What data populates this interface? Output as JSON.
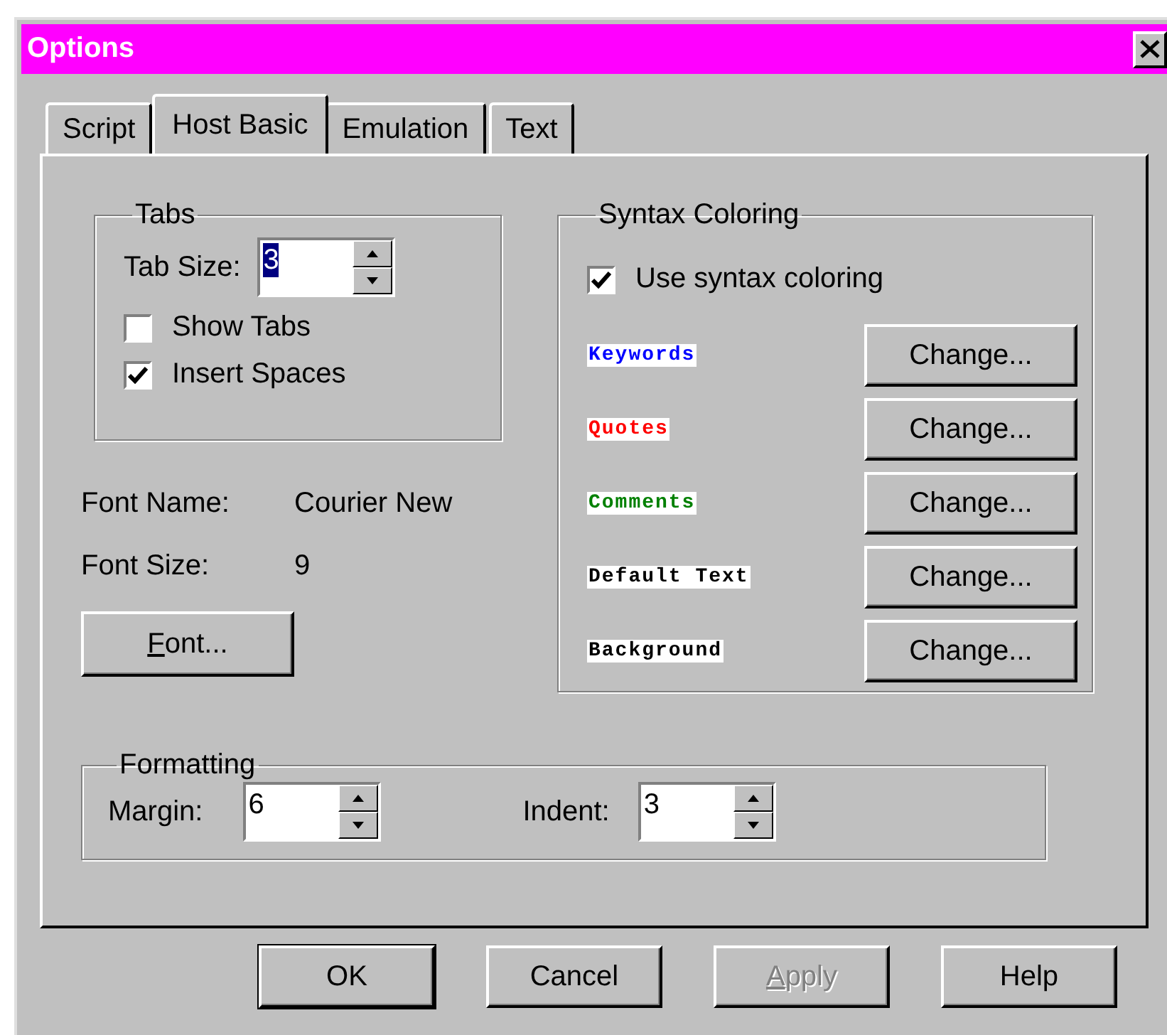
{
  "window": {
    "title": "Options"
  },
  "tabs": [
    {
      "label": "Script",
      "selected": false
    },
    {
      "label": "Host Basic",
      "selected": true
    },
    {
      "label": "Emulation",
      "selected": false
    },
    {
      "label": "Text",
      "selected": false
    }
  ],
  "tabs_group": {
    "title": "Tabs",
    "tab_size": {
      "label": "Tab Size:",
      "value": "3",
      "highlighted": true
    },
    "checkboxes": [
      {
        "label": "Show Tabs",
        "checked": false
      },
      {
        "label": "Insert Spaces",
        "checked": true
      }
    ]
  },
  "font_info": [
    {
      "label": "Font Name:",
      "value": "Courier New"
    },
    {
      "label": "Font Size:",
      "value": "9"
    }
  ],
  "font_button": {
    "label": "Font...",
    "underline_first": true
  },
  "syntax": {
    "title": "Syntax Coloring",
    "use_syntax": {
      "label": "Use syntax coloring",
      "checked": true
    },
    "items": [
      {
        "label": "Keywords",
        "color": "#0000ff",
        "button": "Change..."
      },
      {
        "label": "Quotes",
        "color": "#ff0000",
        "button": "Change..."
      },
      {
        "label": "Comments",
        "color": "#008000",
        "button": "Change..."
      },
      {
        "label": "Default Text",
        "color": "#000000",
        "button": "Change..."
      },
      {
        "label": "Background",
        "color": "#000000",
        "button": "Change..."
      }
    ]
  },
  "formatting": {
    "title": "Formatting",
    "fields": [
      {
        "label": "Margin:",
        "value": "6"
      },
      {
        "label": "Indent:",
        "value": "3"
      }
    ]
  },
  "buttons": [
    {
      "label": "OK",
      "default": true,
      "disabled": false,
      "underline_first": false
    },
    {
      "label": "Cancel",
      "default": false,
      "disabled": false,
      "underline_first": false
    },
    {
      "label": "Apply",
      "default": false,
      "disabled": true,
      "underline_first": true
    },
    {
      "label": "Help",
      "default": false,
      "disabled": false,
      "underline_first": false
    }
  ]
}
